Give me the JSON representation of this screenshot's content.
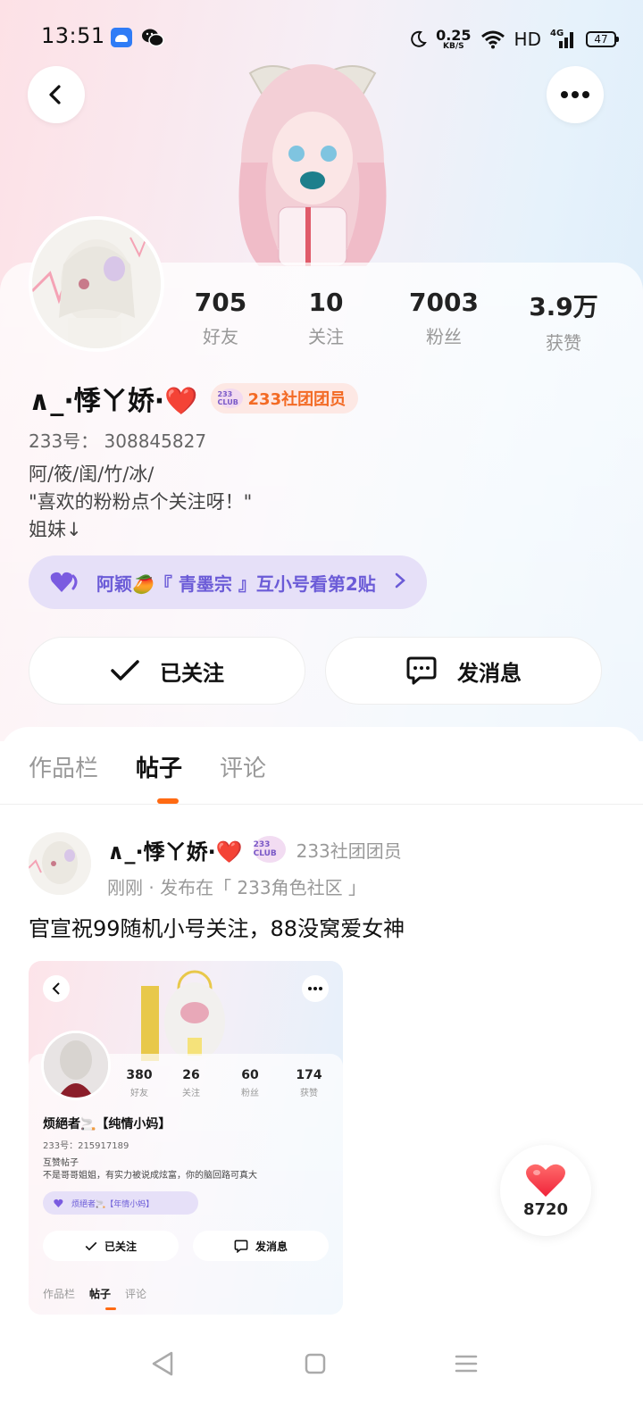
{
  "status_bar": {
    "time": "13:51",
    "net_speed_value": "0.25",
    "net_speed_unit": "KB/S",
    "hd": "HD",
    "signal": "4G",
    "battery": "47"
  },
  "profile": {
    "stats": [
      {
        "value": "705",
        "label": "好友"
      },
      {
        "value": "10",
        "label": "关注"
      },
      {
        "value": "7003",
        "label": "粉丝"
      },
      {
        "value": "3.9万",
        "label": "获赞"
      }
    ],
    "name": "∧_·悸ㄚ娇·❤️",
    "club_icon_text": "233 CLUB",
    "club_badge": "233社团团员",
    "user_id": "233号： 308845827",
    "bio_lines": [
      "阿/筱/闺/竹/冰/",
      "\"喜欢的粉粉点个关注呀！\"",
      "姐妹↓"
    ],
    "pinned_post": "阿颖🥭『 青墨宗 』互小号看第2贴",
    "follow_label": "已关注",
    "message_label": "发消息"
  },
  "tabs": [
    {
      "label": "作品栏"
    },
    {
      "label": "帖子"
    },
    {
      "label": "评论"
    }
  ],
  "post": {
    "author": "∧_·悸ㄚ娇·❤️",
    "club_icon_text": "233 CLUB",
    "club_text": "233社团团员",
    "meta": "刚刚 · 发布在「 233角色社区 」",
    "title": "官宣祝99随机小号关注，88没窝爱女神",
    "image": {
      "stats": [
        {
          "value": "380",
          "label": "好友"
        },
        {
          "value": "26",
          "label": "关注"
        },
        {
          "value": "60",
          "label": "粉丝"
        },
        {
          "value": "174",
          "label": "获赞"
        }
      ],
      "name": "烦絕者🚬【纯情小妈】",
      "user_id": "233号：215917189",
      "bio_lines": [
        "互赞帖子",
        "不是哥哥姐姐，有实力被说成炫富，你的脑回路可真大"
      ],
      "pinned": "烦絕者🚬【年情小妈】",
      "follow_label": "已关注",
      "message_label": "发消息",
      "tabs": [
        "作品栏",
        "帖子",
        "评论"
      ]
    }
  },
  "like_count": "8720",
  "colors": {
    "accent": "#ff6a13",
    "pin_purple": "#6b5bd7",
    "club_orange": "#f36a24"
  }
}
